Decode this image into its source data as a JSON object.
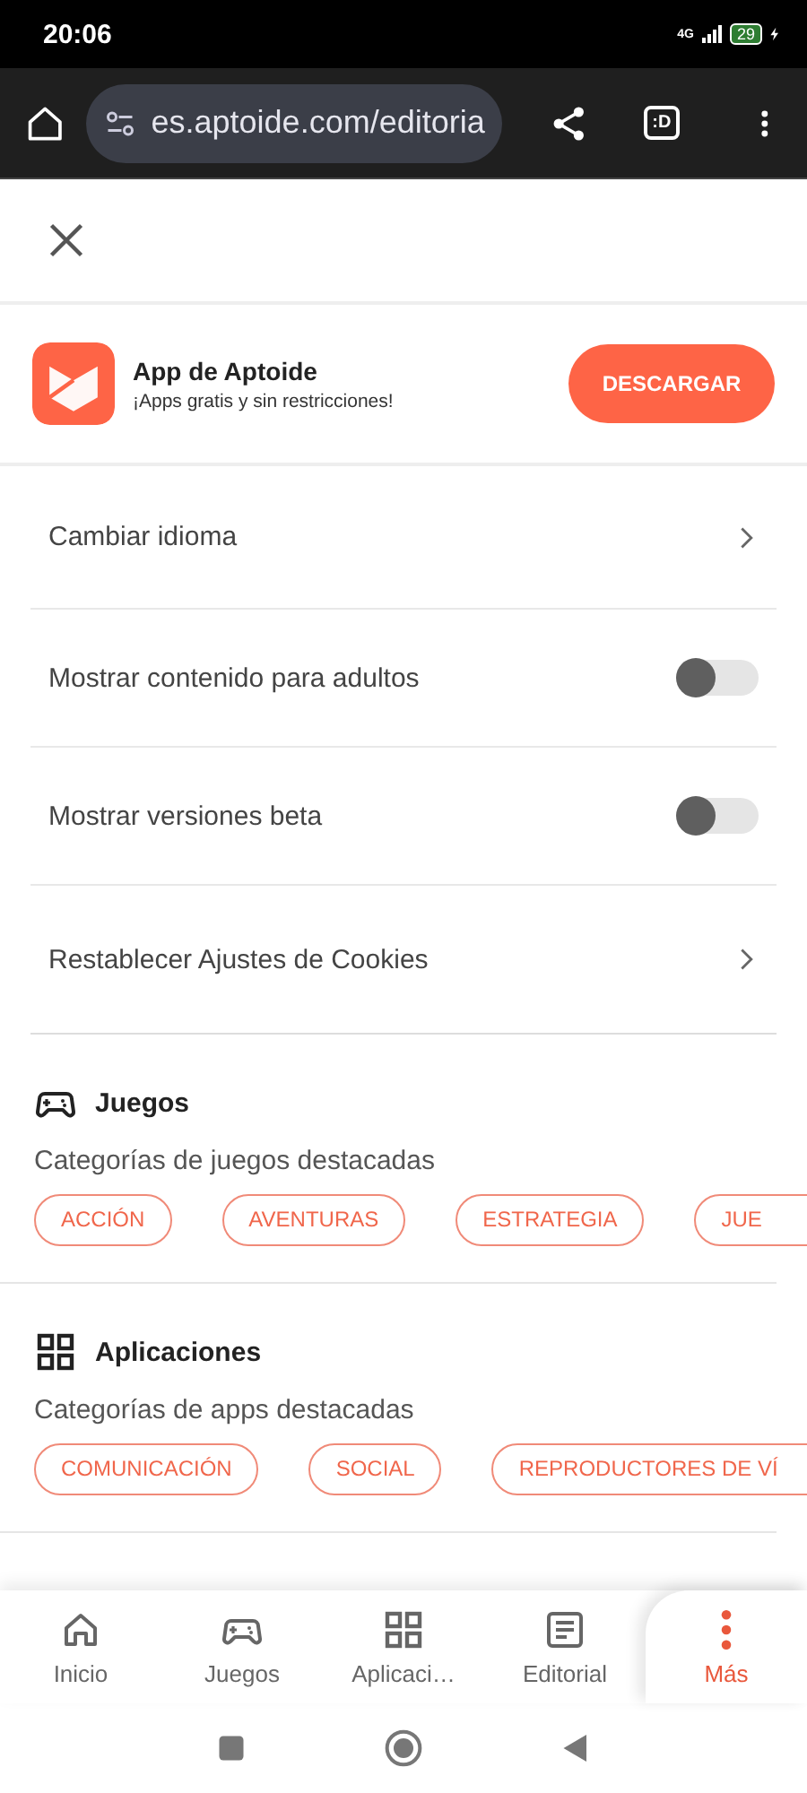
{
  "status_bar": {
    "time": "20:06",
    "network": "4G",
    "battery": "29"
  },
  "browser": {
    "url": "es.aptoide.com/editoria",
    "tab_label": ":D"
  },
  "banner": {
    "title": "App de Aptoide",
    "subtitle": "¡Apps gratis y sin restricciones!",
    "button": "DESCARGAR"
  },
  "settings": [
    {
      "kind": "link",
      "label": "Cambiar idioma"
    },
    {
      "kind": "toggle",
      "label": "Mostrar contenido para adultos",
      "on": false
    },
    {
      "kind": "toggle",
      "label": "Mostrar versiones beta",
      "on": false
    },
    {
      "kind": "link",
      "label": "Restablecer Ajustes de Cookies"
    }
  ],
  "sections": [
    {
      "kind": "games",
      "title": "Juegos",
      "subtitle": "Categorías de juegos destacadas",
      "chips": [
        "ACCIÓN",
        "AVENTURAS",
        "ESTRATEGIA",
        "JUE"
      ]
    },
    {
      "kind": "apps",
      "title": "Aplicaciones",
      "subtitle": "Categorías de apps destacadas",
      "chips": [
        "COMUNICACIÓN",
        "SOCIAL",
        "REPRODUCTORES DE VÍ"
      ]
    }
  ],
  "bottom_nav": [
    {
      "kind": "home",
      "label": "Inicio",
      "selected": false
    },
    {
      "kind": "games",
      "label": "Juegos",
      "selected": false
    },
    {
      "kind": "apps",
      "label": "Aplicaci…",
      "selected": false
    },
    {
      "kind": "editorial",
      "label": "Editorial",
      "selected": false
    },
    {
      "kind": "more",
      "label": "Más",
      "selected": true
    }
  ]
}
